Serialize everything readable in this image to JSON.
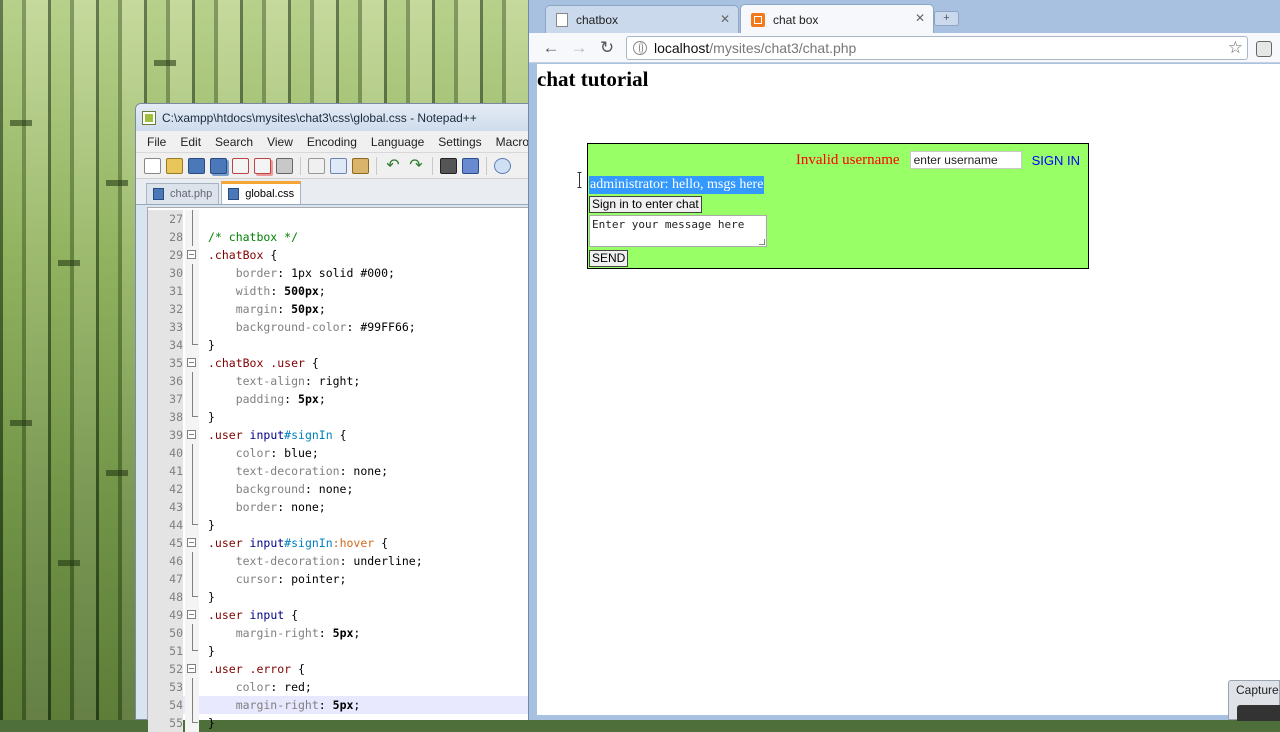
{
  "notepad": {
    "title": "C:\\xampp\\htdocs\\mysites\\chat3\\css\\global.css - Notepad++",
    "menu": [
      "File",
      "Edit",
      "Search",
      "View",
      "Encoding",
      "Language",
      "Settings",
      "Macro"
    ],
    "tabs": [
      {
        "label": "chat.php",
        "active": false
      },
      {
        "label": "global.css",
        "active": true
      }
    ],
    "lines": [
      {
        "n": "27",
        "fold": "line",
        "tokens": []
      },
      {
        "n": "28",
        "fold": "line",
        "tokens": [
          {
            "t": "/* chatbox */",
            "c": "c-comment"
          }
        ]
      },
      {
        "n": "29",
        "fold": "box",
        "tokens": [
          {
            "t": ".chatBox",
            "c": "c-sel"
          },
          {
            "t": " {",
            "c": "c-plain"
          }
        ]
      },
      {
        "n": "30",
        "fold": "line",
        "tokens": [
          {
            "t": "    border",
            "c": "c-prop"
          },
          {
            "t": ": 1px solid #000;",
            "c": "c-plain"
          }
        ]
      },
      {
        "n": "31",
        "fold": "line",
        "tokens": [
          {
            "t": "    width",
            "c": "c-prop"
          },
          {
            "t": ": ",
            "c": "c-plain"
          },
          {
            "t": "500px",
            "c": "c-val"
          },
          {
            "t": ";",
            "c": "c-plain"
          }
        ]
      },
      {
        "n": "32",
        "fold": "line",
        "tokens": [
          {
            "t": "    margin",
            "c": "c-prop"
          },
          {
            "t": ": ",
            "c": "c-plain"
          },
          {
            "t": "50px",
            "c": "c-val"
          },
          {
            "t": ";",
            "c": "c-plain"
          }
        ]
      },
      {
        "n": "33",
        "fold": "line",
        "tokens": [
          {
            "t": "    background-color",
            "c": "c-prop"
          },
          {
            "t": ": #99FF66;",
            "c": "c-plain"
          }
        ]
      },
      {
        "n": "34",
        "fold": "end",
        "tokens": [
          {
            "t": "}",
            "c": "c-plain"
          }
        ]
      },
      {
        "n": "35",
        "fold": "box",
        "tokens": [
          {
            "t": ".chatBox .user",
            "c": "c-sel"
          },
          {
            "t": " {",
            "c": "c-plain"
          }
        ]
      },
      {
        "n": "36",
        "fold": "line",
        "tokens": [
          {
            "t": "    text-align",
            "c": "c-prop"
          },
          {
            "t": ": right;",
            "c": "c-plain"
          }
        ]
      },
      {
        "n": "37",
        "fold": "line",
        "tokens": [
          {
            "t": "    padding",
            "c": "c-prop"
          },
          {
            "t": ": ",
            "c": "c-plain"
          },
          {
            "t": "5px",
            "c": "c-val"
          },
          {
            "t": ";",
            "c": "c-plain"
          }
        ]
      },
      {
        "n": "38",
        "fold": "end",
        "tokens": [
          {
            "t": "}",
            "c": "c-plain"
          }
        ]
      },
      {
        "n": "39",
        "fold": "box",
        "tokens": [
          {
            "t": ".user ",
            "c": "c-sel"
          },
          {
            "t": "input",
            "c": "c-tag"
          },
          {
            "t": "#signIn",
            "c": "c-id"
          },
          {
            "t": " {",
            "c": "c-plain"
          }
        ]
      },
      {
        "n": "40",
        "fold": "line",
        "tokens": [
          {
            "t": "    color",
            "c": "c-prop"
          },
          {
            "t": ": blue;",
            "c": "c-plain"
          }
        ]
      },
      {
        "n": "41",
        "fold": "line",
        "tokens": [
          {
            "t": "    text-decoration",
            "c": "c-prop"
          },
          {
            "t": ": none;",
            "c": "c-plain"
          }
        ]
      },
      {
        "n": "42",
        "fold": "line",
        "tokens": [
          {
            "t": "    background",
            "c": "c-prop"
          },
          {
            "t": ": none;",
            "c": "c-plain"
          }
        ]
      },
      {
        "n": "43",
        "fold": "line",
        "tokens": [
          {
            "t": "    border",
            "c": "c-prop"
          },
          {
            "t": ": none;",
            "c": "c-plain"
          }
        ]
      },
      {
        "n": "44",
        "fold": "end",
        "tokens": [
          {
            "t": "}",
            "c": "c-plain"
          }
        ]
      },
      {
        "n": "45",
        "fold": "box",
        "tokens": [
          {
            "t": ".user ",
            "c": "c-sel"
          },
          {
            "t": "input",
            "c": "c-tag"
          },
          {
            "t": "#signIn",
            "c": "c-id"
          },
          {
            "t": ":hover",
            "c": "c-pseudo"
          },
          {
            "t": " {",
            "c": "c-plain"
          }
        ]
      },
      {
        "n": "46",
        "fold": "line",
        "tokens": [
          {
            "t": "    text-decoration",
            "c": "c-prop"
          },
          {
            "t": ": underline;",
            "c": "c-plain"
          }
        ]
      },
      {
        "n": "47",
        "fold": "line",
        "tokens": [
          {
            "t": "    cursor",
            "c": "c-prop"
          },
          {
            "t": ": pointer;",
            "c": "c-plain"
          }
        ]
      },
      {
        "n": "48",
        "fold": "end",
        "tokens": [
          {
            "t": "}",
            "c": "c-plain"
          }
        ]
      },
      {
        "n": "49",
        "fold": "box",
        "tokens": [
          {
            "t": ".user ",
            "c": "c-sel"
          },
          {
            "t": "input",
            "c": "c-tag"
          },
          {
            "t": " {",
            "c": "c-plain"
          }
        ]
      },
      {
        "n": "50",
        "fold": "line",
        "tokens": [
          {
            "t": "    margin-right",
            "c": "c-prop"
          },
          {
            "t": ": ",
            "c": "c-plain"
          },
          {
            "t": "5px",
            "c": "c-val"
          },
          {
            "t": ";",
            "c": "c-plain"
          }
        ]
      },
      {
        "n": "51",
        "fold": "end",
        "tokens": [
          {
            "t": "}",
            "c": "c-plain"
          }
        ]
      },
      {
        "n": "52",
        "fold": "box",
        "tokens": [
          {
            "t": ".user .error",
            "c": "c-sel"
          },
          {
            "t": " {",
            "c": "c-plain"
          }
        ]
      },
      {
        "n": "53",
        "fold": "line",
        "tokens": [
          {
            "t": "    color",
            "c": "c-prop"
          },
          {
            "t": ": red;",
            "c": "c-plain"
          }
        ]
      },
      {
        "n": "54",
        "fold": "line",
        "current": true,
        "tokens": [
          {
            "t": "    margin-right",
            "c": "c-prop"
          },
          {
            "t": ": ",
            "c": "c-plain"
          },
          {
            "t": "5px",
            "c": "c-val"
          },
          {
            "t": ";",
            "c": "c-plain"
          }
        ]
      },
      {
        "n": "55",
        "fold": "end",
        "tokens": [
          {
            "t": "}",
            "c": "c-plain"
          }
        ]
      }
    ]
  },
  "chrome": {
    "tabs": [
      {
        "label": "chatbox",
        "active": false
      },
      {
        "label": "chat box",
        "active": true
      }
    ],
    "url_host": "localhost",
    "url_path": "/mysites/chat3/chat.php",
    "icons": {
      "back": "back-arrow-icon",
      "forward": "forward-arrow-icon",
      "reload": "reload-icon",
      "star": "bookmark-star-icon",
      "wrench": "wrench-icon"
    }
  },
  "page": {
    "heading": "chat tutorial",
    "error_text": "Invalid username",
    "username_value": "enter username",
    "signin_label": "SIGN IN",
    "message": "administrator: hello, msgs here",
    "signin_chat_button": "Sign in to enter chat",
    "textarea_value": "Enter your message here",
    "send_label": "SEND",
    "colors": {
      "chatbox_bg": "#99FF66",
      "error": "#ff0000",
      "signin": "#0000ff",
      "selection": "#3399ff"
    }
  },
  "taskbar": {
    "capture_label": "Capture"
  }
}
